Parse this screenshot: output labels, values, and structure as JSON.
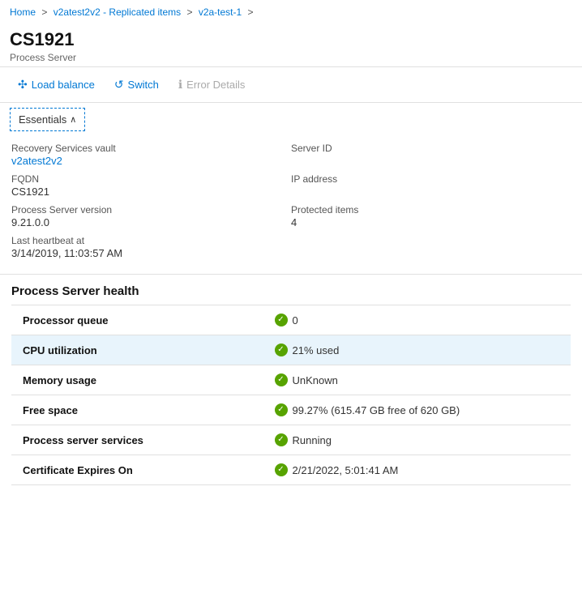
{
  "breadcrumb": {
    "items": [
      {
        "label": "Home",
        "href": "#"
      },
      {
        "label": "v2atest2v2 - Replicated items",
        "href": "#"
      },
      {
        "label": "v2a-test-1",
        "href": "#"
      }
    ],
    "separator": ">"
  },
  "header": {
    "title": "CS1921",
    "subtitle": "Process Server"
  },
  "toolbar": {
    "buttons": [
      {
        "label": "Load balance",
        "icon": "⇄",
        "disabled": false,
        "name": "load-balance-button"
      },
      {
        "label": "Switch",
        "icon": "↺",
        "disabled": false,
        "name": "switch-button"
      },
      {
        "label": "Error Details",
        "icon": "ℹ",
        "disabled": true,
        "name": "error-details-button"
      }
    ]
  },
  "essentials": {
    "tab_label": "Essentials",
    "fields": [
      {
        "label": "Recovery Services vault",
        "value": "v2atest2v2",
        "link": true,
        "col": 0
      },
      {
        "label": "Server ID",
        "value": "",
        "link": false,
        "col": 1
      },
      {
        "label": "FQDN",
        "value": "CS1921",
        "link": false,
        "col": 0
      },
      {
        "label": "IP address",
        "value": "",
        "link": false,
        "col": 1
      },
      {
        "label": "Process Server version",
        "value": "9.21.0.0",
        "link": false,
        "col": 0
      },
      {
        "label": "Protected items",
        "value": "4",
        "link": false,
        "col": 1
      },
      {
        "label": "Last heartbeat at",
        "value": "3/14/2019, 11:03:57 AM",
        "link": false,
        "col": 0
      }
    ]
  },
  "health": {
    "section_title": "Process Server health",
    "rows": [
      {
        "label": "Processor queue",
        "value": "0",
        "status": "ok",
        "highlighted": false
      },
      {
        "label": "CPU utilization",
        "value": "21% used",
        "status": "ok",
        "highlighted": true
      },
      {
        "label": "Memory usage",
        "value": "UnKnown",
        "status": "ok",
        "highlighted": false
      },
      {
        "label": "Free space",
        "value": "99.27% (615.47 GB free of 620 GB)",
        "status": "ok",
        "highlighted": false
      },
      {
        "label": "Process server services",
        "value": "Running",
        "status": "ok",
        "highlighted": false
      },
      {
        "label": "Certificate Expires On",
        "value": "2/21/2022, 5:01:41 AM",
        "status": "ok",
        "highlighted": false
      }
    ]
  }
}
